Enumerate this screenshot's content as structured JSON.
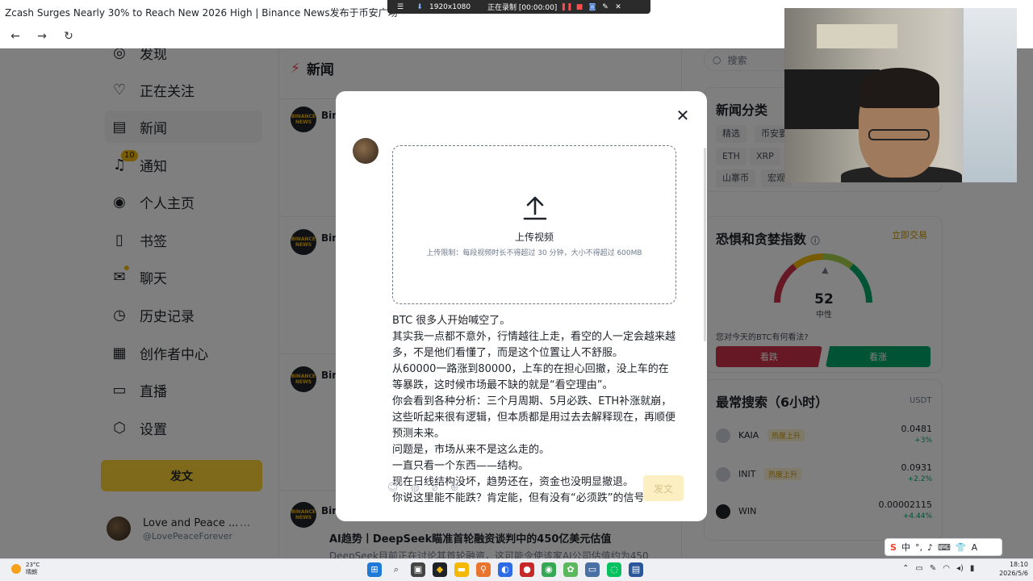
{
  "browser": {
    "tab_title": "Zcash Surges Nearly 30% to Reach New 2026 High | Binance News发布于币安广场",
    "back_icon": "←",
    "forward_icon": "→",
    "refresh_icon": "↻"
  },
  "recorder": {
    "resolution": "1920x1080",
    "status": "正在录制 [00:00:00]"
  },
  "sidebar": {
    "items": [
      {
        "label": "发现",
        "icon": "◎"
      },
      {
        "label": "正在关注",
        "icon": "♡"
      },
      {
        "label": "新闻",
        "icon": "▤"
      },
      {
        "label": "通知",
        "icon": "🔔",
        "badge": "10"
      },
      {
        "label": "个人主页",
        "icon": "◉"
      },
      {
        "label": "书签",
        "icon": "▯"
      },
      {
        "label": "聊天",
        "icon": "✉"
      },
      {
        "label": "历史记录",
        "icon": "◷"
      },
      {
        "label": "创作者中心",
        "icon": "▦"
      },
      {
        "label": "直播",
        "icon": "▭"
      },
      {
        "label": "设置",
        "icon": "⬡"
      }
    ],
    "post_button": "发文",
    "profile": {
      "name": "Love and Peace ...",
      "handle": "@LovePeaceForever",
      "more": "···"
    }
  },
  "feed": {
    "title": "新闻",
    "author_short": "Bin",
    "logo_text": "BINANCE NEWS",
    "bottom_post_title": "AI趋势丨DeepSeek瞄准首轮融资谈判中的450亿美元估值",
    "bottom_post_snippet": "DeepSeek目前正在讨论其首轮融资，这可能令使该家AI公司估值约为450"
  },
  "right": {
    "search_placeholder": "搜索",
    "news_categories_title": "新闻分类",
    "chips_row1": [
      "精选",
      "币安要"
    ],
    "chips_row2": [
      "ETH",
      "XRP"
    ],
    "chips_row3": [
      "山寨币",
      "宏观"
    ],
    "fear_greed_title": "恐惧和贪婪指数",
    "trade_now": "立即交易",
    "gauge_value": 52,
    "gauge_label": "中性",
    "question": "您对今天的BTC有何看法?",
    "bearish": "看跌",
    "bullish": "看涨",
    "trending_title": "最常搜索（6小时）",
    "trending_unit": "USDT",
    "coins": [
      {
        "name": "KAIA",
        "tag": "热度上升",
        "price": "0.0481",
        "change": "+3%"
      },
      {
        "name": "INIT",
        "tag": "热度上升",
        "price": "0.0931",
        "change": "+2.2%"
      },
      {
        "name": "WIN",
        "tag": "",
        "price": "0.00002115",
        "change": "+4.44%"
      }
    ],
    "colors": {
      "bearish": "#cf304a",
      "bullish": "#03a66d",
      "accent": "#f0b90b"
    }
  },
  "modal": {
    "upload_title": "上传视频",
    "upload_hint": "上传限制：每段视频时长不得超过 30 分钟，大小不得超过 600MB",
    "post_lines": [
      "BTC 很多人开始喊空了。",
      "其实我一点都不意外，行情越往上走，看空的人一定会越来越多，不是他们看懂了，而是这个位置让人不舒服。",
      "从60000一路涨到80000，上车的在担心回撤，没上车的在等暴跌，这时候市场最不缺的就是“看空理由”。",
      "你会看到各种分析：三个月周期、5月必跌、ETH补涨就崩，这些听起来很有逻辑，但本质都是用过去去解释现在，再顺便预测未来。",
      "问题是，市场从来不是这么走的。",
      "一直只看一个东西——结构。",
      "现在日线结构没坏，趋势还在，资金也没明显撤退。",
      "你说这里能不能跌？肯定能，但有没有“必须跌”的信号?"
    ],
    "submit": "发文",
    "close_icon": "✕"
  },
  "taskbar": {
    "temp": "23°C",
    "weather": "晴朗",
    "time": "18:10",
    "date": "2026/5/6",
    "ime_lang": "中"
  }
}
